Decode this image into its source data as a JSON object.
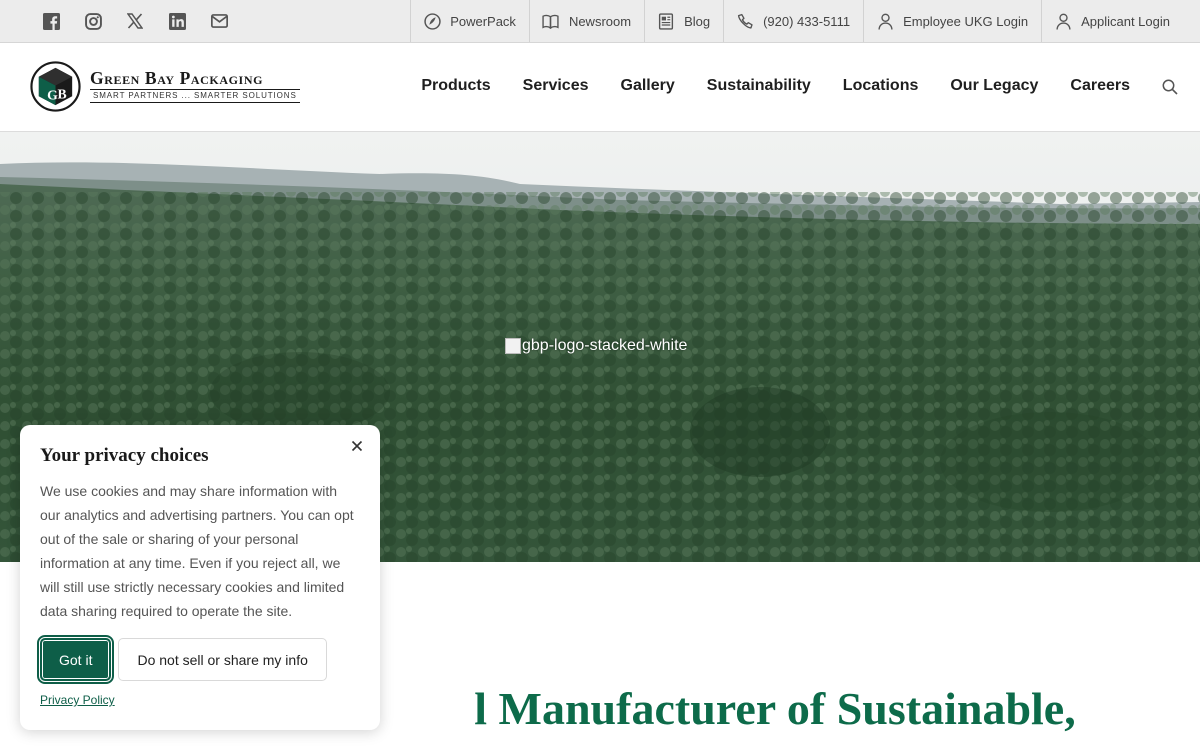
{
  "topbar": {
    "social": [
      {
        "name": "facebook-icon"
      },
      {
        "name": "instagram-icon"
      },
      {
        "name": "x-twitter-icon"
      },
      {
        "name": "linkedin-icon"
      },
      {
        "name": "mail-icon"
      }
    ],
    "links": [
      {
        "icon": "powerpack-icon",
        "label": "PowerPack"
      },
      {
        "icon": "book-icon",
        "label": "Newsroom"
      },
      {
        "icon": "newspaper-icon",
        "label": "Blog"
      },
      {
        "icon": "phone-icon",
        "label": "(920) 433-5111"
      },
      {
        "icon": "user-icon",
        "label": "Employee UKG Login"
      },
      {
        "icon": "user-icon",
        "label": "Applicant Login"
      }
    ]
  },
  "header": {
    "logo": {
      "initials": "GB",
      "name": "Green Bay Packaging",
      "tagline": "SMART PARTNERS ... SMARTER SOLUTIONS"
    },
    "nav": [
      "Products",
      "Services",
      "Gallery",
      "Sustainability",
      "Locations",
      "Our Legacy",
      "Careers"
    ],
    "search_icon": "search-icon"
  },
  "hero": {
    "image_alt": "gbp-logo-stacked-white"
  },
  "headline": {
    "text": "l Manufacturer of Sustainable,"
  },
  "cookie": {
    "title": "Your privacy choices",
    "body": "We use cookies and may share information with our analytics and advertising partners. You can opt out of the sale or sharing of your personal information at any time. Even if you reject all, we will still use strictly necessary cookies and limited data sharing required to operate the site.",
    "accept": "Got it",
    "decline": "Do not sell or share my info",
    "privacy_link": "Privacy Policy"
  },
  "colors": {
    "brand_green": "#0e5e48",
    "headline_green": "#0d6b4a",
    "topbar_bg": "#ececec"
  }
}
